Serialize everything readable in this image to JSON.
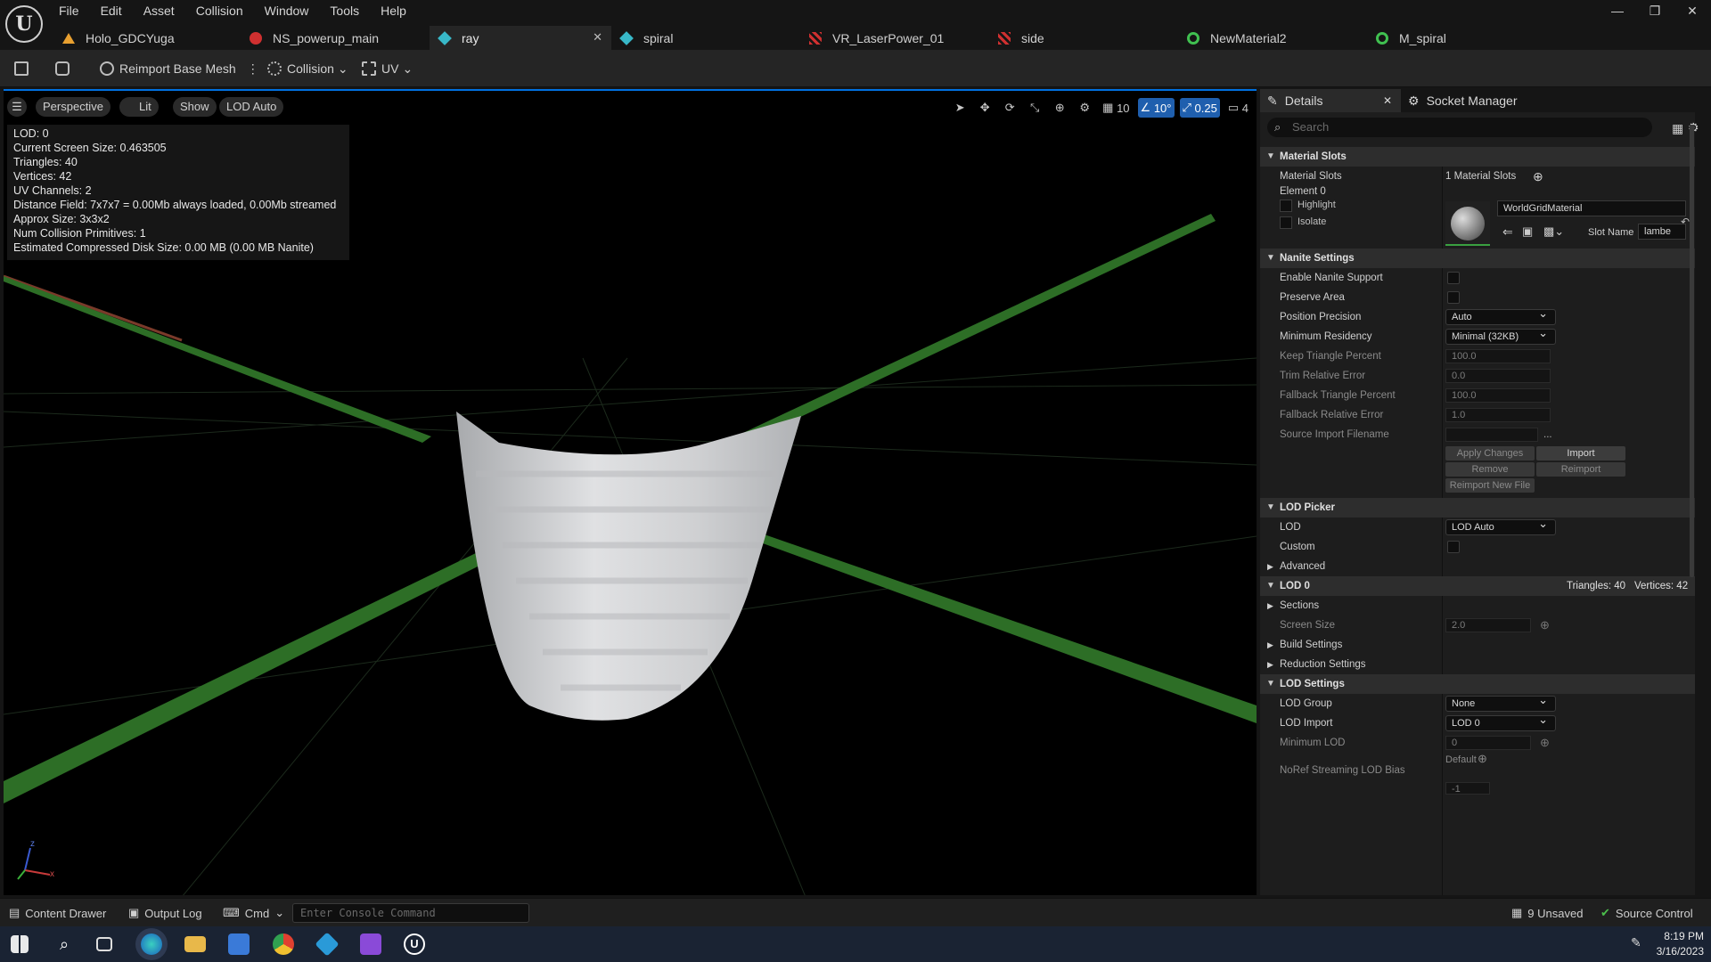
{
  "app": {
    "logo_letter": "U"
  },
  "menu": [
    "File",
    "Edit",
    "Asset",
    "Collision",
    "Window",
    "Tools",
    "Help"
  ],
  "window_controls": {
    "minimize": "—",
    "restore": "❐",
    "close": "✕"
  },
  "tabs": [
    {
      "label": "Holo_GDCYuga",
      "icon_color": "#e8a030",
      "active": false
    },
    {
      "label": "NS_powerup_main",
      "icon_color": "#d03030",
      "active": false
    },
    {
      "label": "ray",
      "icon_color": "#38b8c8",
      "active": true
    },
    {
      "label": "spiral",
      "icon_color": "#38b8c8",
      "active": false
    },
    {
      "label": "VR_LaserPower_01",
      "icon_color": "#d03030",
      "active": false
    },
    {
      "label": "side",
      "icon_color": "#d03030",
      "active": false
    },
    {
      "label": "NewMaterial2",
      "icon_color": "#40c050",
      "active": false
    },
    {
      "label": "M_spiral",
      "icon_color": "#40c050",
      "active": false
    }
  ],
  "tab_close": "✕",
  "toolbar": {
    "reimport_label": "Reimport Base Mesh",
    "collision_label": "Collision",
    "uv_label": "UV",
    "more": "⋮"
  },
  "viewport": {
    "perspective": "Perspective",
    "lit": "Lit",
    "show": "Show",
    "lod": "LOD Auto",
    "stats": [
      "LOD:  0",
      "Current Screen Size:  0.463505",
      "Triangles:  40",
      "Vertices:  42",
      "UV Channels:  2",
      "Distance Field:  7x7x7 = 0.00Mb always loaded, 0.00Mb streamed",
      "Approx Size: 3x3x2",
      "Num Collision Primitives:  1",
      "Estimated Compressed Disk Size: 0.00 MB (0.00 MB Nanite)"
    ],
    "grid_value": "10",
    "angle_value": "10°",
    "scale_value": "0.25",
    "camera_value": "4",
    "axis": {
      "z": "z",
      "x": "x"
    }
  },
  "details": {
    "tab_details": "Details",
    "tab_close": "✕",
    "tab_socket": "Socket Manager",
    "search_placeholder": "Search",
    "material_slots": {
      "header": "Material Slots",
      "label": "Material Slots",
      "count": "1 Material Slots",
      "element": "Element 0",
      "highlight": "Highlight",
      "isolate": "Isolate",
      "material_name": "WorldGridMaterial",
      "slot_name_label": "Slot Name",
      "slot_name_value": "lambe"
    },
    "nanite": {
      "header": "Nanite Settings",
      "enable": "Enable Nanite Support",
      "preserve": "Preserve Area",
      "position_precision": "Position Precision",
      "position_precision_value": "Auto",
      "min_residency": "Minimum Residency",
      "min_residency_value": "Minimal (32KB)",
      "keep_triangle": "Keep Triangle Percent",
      "keep_triangle_value": "100.0",
      "trim_error": "Trim Relative Error",
      "trim_error_value": "0.0",
      "fallback_triangle": "Fallback Triangle Percent",
      "fallback_triangle_value": "100.0",
      "fallback_error": "Fallback Relative Error",
      "fallback_error_value": "1.0",
      "source_import": "Source Import Filename",
      "source_more": "...",
      "apply": "Apply Changes",
      "import": "Import",
      "remove": "Remove",
      "reimport": "Reimport",
      "reimport_new": "Reimport New File"
    },
    "lod_picker": {
      "header": "LOD Picker",
      "lod": "LOD",
      "lod_value": "LOD Auto",
      "custom": "Custom",
      "advanced": "Advanced"
    },
    "lod0": {
      "header": "LOD 0",
      "triangles": "Triangles: 40",
      "vertices": "Vertices: 42",
      "sections": "Sections",
      "screen_size": "Screen Size",
      "screen_size_value": "2.0",
      "build": "Build Settings",
      "reduction": "Reduction Settings"
    },
    "lod_settings": {
      "header": "LOD Settings",
      "group": "LOD Group",
      "group_value": "None",
      "import": "LOD Import",
      "import_value": "LOD 0",
      "min_lod": "Minimum LOD",
      "min_lod_value": "0",
      "noref": "NoRef Streaming LOD Bias",
      "default": "Default",
      "noref_value": "-1"
    }
  },
  "status": {
    "content_drawer": "Content Drawer",
    "output_log": "Output Log",
    "cmd": "Cmd",
    "console_placeholder": "Enter Console Command",
    "unsaved": "9 Unsaved",
    "source_control": "Source Control"
  },
  "clock": {
    "time": "8:19 PM",
    "date": "3/16/2023"
  },
  "colors": {
    "accent": "#0070e0",
    "grid_green": "#2a6a22",
    "mesh": "#d9dadc"
  }
}
